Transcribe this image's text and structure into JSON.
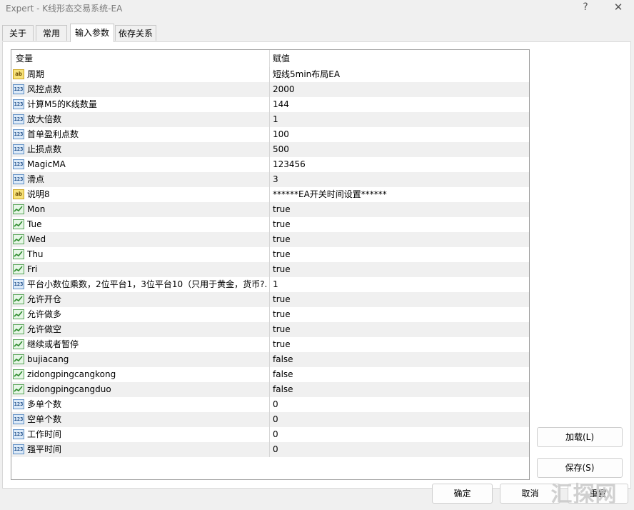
{
  "window": {
    "title": "Expert - K线形态交易系统-EA",
    "help_label": "?",
    "close_label": "✕"
  },
  "tabs": [
    {
      "label": "关于",
      "active": false
    },
    {
      "label": "常用",
      "active": false
    },
    {
      "label": "输入参数",
      "active": true
    },
    {
      "label": "依存关系",
      "active": false
    }
  ],
  "grid": {
    "columns": {
      "variable": "变量",
      "value": "赋值"
    },
    "rows": [
      {
        "type": "string",
        "name": "周期",
        "value": "短线5min布局EA"
      },
      {
        "type": "number",
        "name": "风控点数",
        "value": "2000"
      },
      {
        "type": "number",
        "name": "计算M5的K线数量",
        "value": "144"
      },
      {
        "type": "number",
        "name": "放大倍数",
        "value": "1"
      },
      {
        "type": "number",
        "name": "首单盈利点数",
        "value": "100"
      },
      {
        "type": "number",
        "name": "止损点数",
        "value": "500"
      },
      {
        "type": "number",
        "name": "MagicMA",
        "value": "123456"
      },
      {
        "type": "number",
        "name": "滑点",
        "value": "3"
      },
      {
        "type": "string",
        "name": "说明8",
        "value": "******EA开关时间设置******"
      },
      {
        "type": "bool",
        "name": "Mon",
        "value": "true"
      },
      {
        "type": "bool",
        "name": "Tue",
        "value": "true"
      },
      {
        "type": "bool",
        "name": "Wed",
        "value": "true"
      },
      {
        "type": "bool",
        "name": "Thu",
        "value": "true"
      },
      {
        "type": "bool",
        "name": "Fri",
        "value": "true"
      },
      {
        "type": "number",
        "name": "平台小数位乘数，2位平台1，3位平台10（只用于黄金，货币?...",
        "value": "1"
      },
      {
        "type": "bool",
        "name": "允许开仓",
        "value": "true"
      },
      {
        "type": "bool",
        "name": "允许做多",
        "value": "true"
      },
      {
        "type": "bool",
        "name": "允许做空",
        "value": "true"
      },
      {
        "type": "bool",
        "name": "继续或者暂停",
        "value": "true"
      },
      {
        "type": "bool",
        "name": "bujiacang",
        "value": "false"
      },
      {
        "type": "bool",
        "name": "zidongpingcangkong",
        "value": "false"
      },
      {
        "type": "bool",
        "name": "zidongpingcangduo",
        "value": "false"
      },
      {
        "type": "number",
        "name": "多单个数",
        "value": "0"
      },
      {
        "type": "number",
        "name": "空单个数",
        "value": "0"
      },
      {
        "type": "number",
        "name": "工作时间",
        "value": "0"
      },
      {
        "type": "number",
        "name": "强平时间",
        "value": "0"
      }
    ]
  },
  "icons": {
    "string": "ab",
    "number": "123"
  },
  "buttons": {
    "load": "加载(L)",
    "save": "保存(S)",
    "ok": "确定",
    "cancel": "取消",
    "reset": "重置"
  },
  "watermark": "汇探网",
  "colors": {
    "odd_row": "#f0f0f0",
    "even_row": "#ffffff",
    "bool_icon": "#56a356",
    "number_icon": "#5a8cc4",
    "string_icon": "#c9a21c"
  }
}
